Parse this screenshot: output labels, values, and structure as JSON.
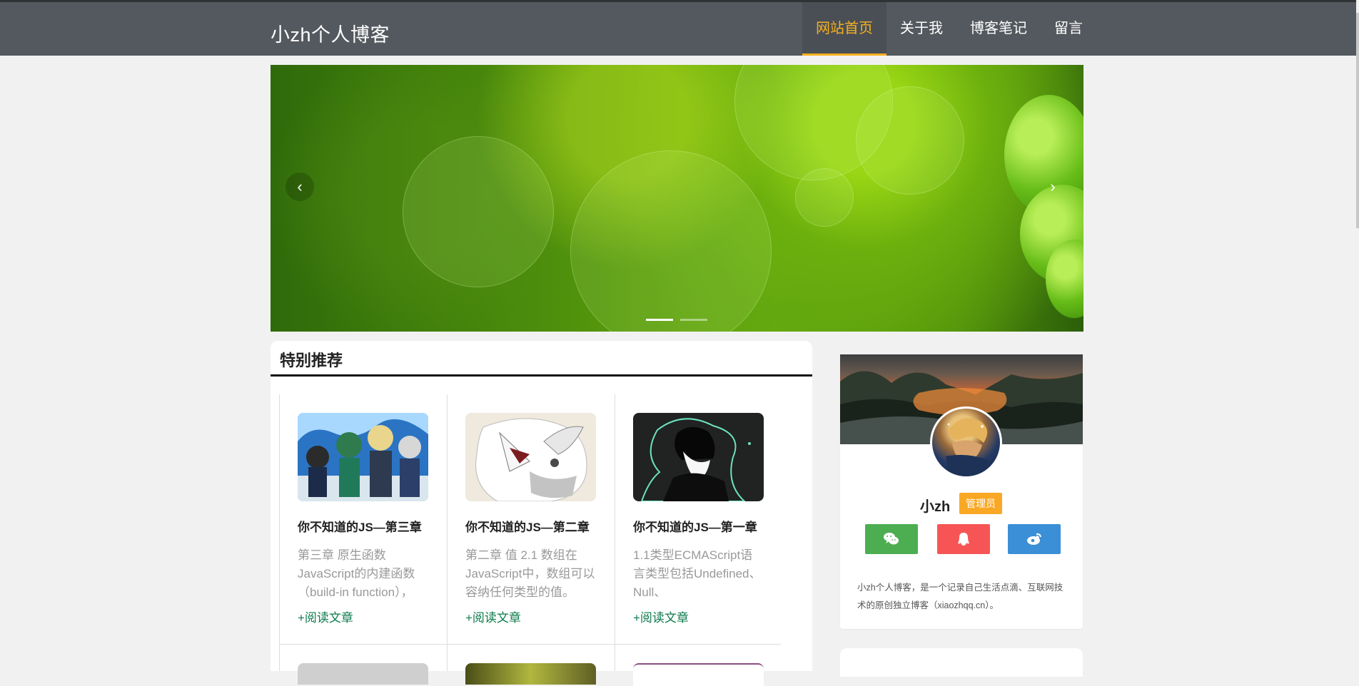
{
  "header": {
    "logo": "小zh个人博客",
    "nav": [
      {
        "label": "网站首页",
        "active": true
      },
      {
        "label": "关于我",
        "active": false
      },
      {
        "label": "博客笔记",
        "active": false
      },
      {
        "label": "留言",
        "active": false
      }
    ]
  },
  "carousel": {
    "prev_icon": "‹",
    "next_icon": "›",
    "slide_count": 2,
    "active_slide": 1
  },
  "featured": {
    "title": "特别推荐",
    "cards": [
      {
        "title": "你不知道的JS—第三章",
        "excerpt": "第三章 原生函数 JavaScript的内建函数（build-in function），",
        "more": "+阅读文章"
      },
      {
        "title": "你不知道的JS—第二章",
        "excerpt": "第二章 值 2.1 数组在 JavaScript中，数组可以容纳任何类型的值。",
        "more": "+阅读文章"
      },
      {
        "title": "你不知道的JS—第一章",
        "excerpt": "1.1类型ECMAScript语言类型包括Undefined、Null、",
        "more": "+阅读文章"
      }
    ]
  },
  "profile": {
    "name": "小zh",
    "badge": "管理员",
    "bio": "小zh个人博客，是一个记录自己生活点滴、互联网技术的原创独立博客（xiaozhqq.cn）。",
    "social": [
      "wechat-icon",
      "qq-icon",
      "weibo-icon"
    ]
  },
  "colors": {
    "header_bg": "#54595f",
    "accent": "#f7b01d",
    "link": "#0c7a4c",
    "badge": "#f9a825"
  }
}
